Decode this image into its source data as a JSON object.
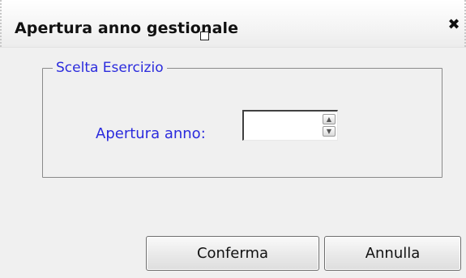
{
  "dialog": {
    "title": "Apertura anno gestionale",
    "close_icon": "close-icon",
    "close_glyph": "✖"
  },
  "fieldset": {
    "legend": "Scelta Esercizio",
    "field_label": "Apertura anno:",
    "field_value": "",
    "spin_up_glyph": "▲",
    "spin_down_glyph": "▼"
  },
  "buttons": {
    "confirm_label": "Conferma",
    "cancel_label": "Annulla"
  },
  "colors": {
    "label_text": "#2b2bdd",
    "background": "#f0f0f0"
  }
}
